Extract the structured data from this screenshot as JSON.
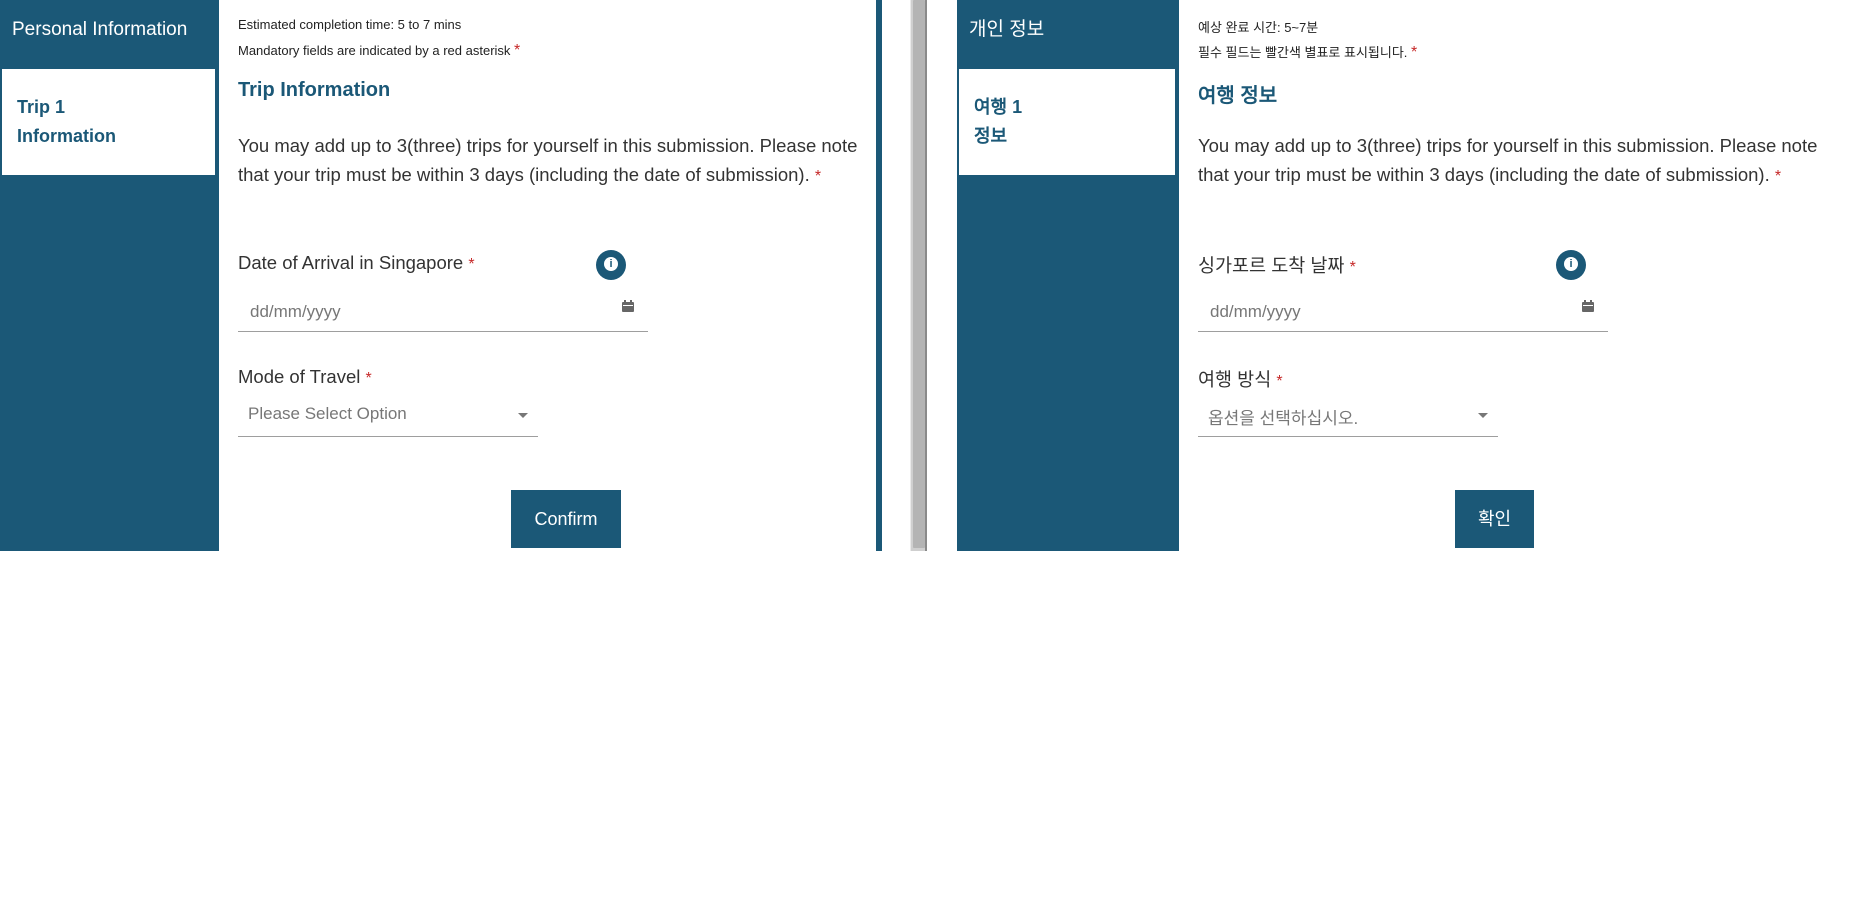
{
  "english": {
    "sidebar": {
      "header": "Personal Information",
      "item_line1": "Trip 1",
      "item_line2": "Information"
    },
    "notes": {
      "completion": "Estimated completion time: 5 to 7 mins",
      "mandatory": "Mandatory fields are indicated by a red asterisk"
    },
    "section_title": "Trip Information",
    "description": "You may add up to 3(three) trips for yourself in this submission. Please note that your trip must be within 3 days (including the date of submission).",
    "date_field": {
      "label": "Date of Arrival in Singapore",
      "placeholder": "dd/mm/yyyy"
    },
    "mode_field": {
      "label": "Mode of Travel",
      "placeholder": "Please Select Option"
    },
    "confirm": "Confirm"
  },
  "korean": {
    "sidebar": {
      "header": "개인 정보",
      "item_line1": "여행 1",
      "item_line2": "정보"
    },
    "notes": {
      "completion": "예상 완료 시간: 5~7분",
      "mandatory": "필수 필드는 빨간색 별표로 표시됩니다."
    },
    "section_title": "여행 정보",
    "description": "You may add up to 3(three) trips for yourself in this submission. Please note that your trip must be within 3 days (including the date of submission).",
    "date_field": {
      "label": "싱가포르 도착 날짜",
      "placeholder": "dd/mm/yyyy"
    },
    "mode_field": {
      "label": "여행 방식",
      "placeholder": "옵션을 선택하십시오."
    },
    "confirm": "확인"
  },
  "required_marker": "*",
  "icons": {
    "info": "info-icon",
    "calendar": "calendar-icon",
    "dropdown": "chevron-down-icon"
  },
  "colors": {
    "brand": "#1b5877",
    "required": "#c62828"
  }
}
